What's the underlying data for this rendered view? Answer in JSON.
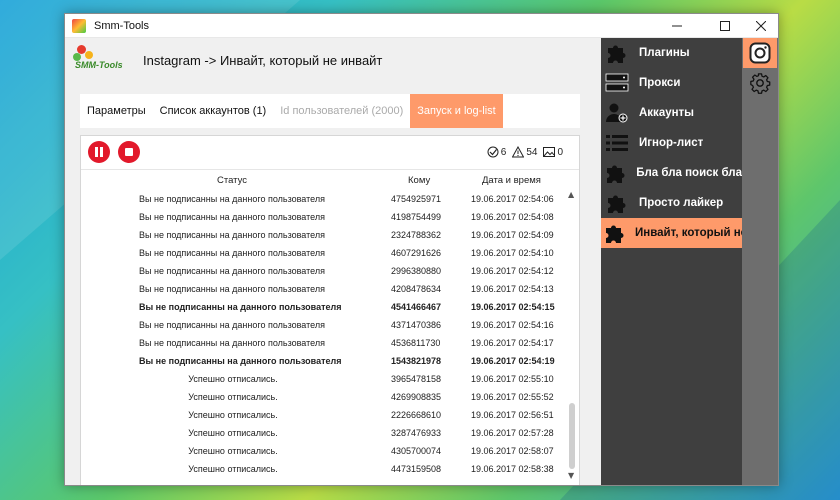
{
  "window": {
    "title": "Smm-Tools"
  },
  "header": {
    "logo_text": "SMM-Tools",
    "title": "Instagram -> Инвайт, который не инвайт"
  },
  "tabs": [
    {
      "label": "Параметры",
      "state": "normal"
    },
    {
      "label": "Список аккаунтов (1)",
      "state": "normal"
    },
    {
      "label": "Id пользователей (2000)",
      "state": "disabled"
    },
    {
      "label": "Запуск и log-list",
      "state": "active"
    }
  ],
  "stats": {
    "success": "6",
    "warnings": "54",
    "images": "0"
  },
  "table": {
    "columns": [
      "Статус",
      "Кому",
      "Дата и время"
    ],
    "rows": [
      {
        "status": "Вы не подписанны на данного пользователя",
        "to": "4754925971",
        "date": "19.06.2017 02:54:06",
        "bold": false
      },
      {
        "status": "Вы не подписанны на данного пользователя",
        "to": "4198754499",
        "date": "19.06.2017 02:54:08",
        "bold": false
      },
      {
        "status": "Вы не подписанны на данного пользователя",
        "to": "2324788362",
        "date": "19.06.2017 02:54:09",
        "bold": false
      },
      {
        "status": "Вы не подписанны на данного пользователя",
        "to": "4607291626",
        "date": "19.06.2017 02:54:10",
        "bold": false
      },
      {
        "status": "Вы не подписанны на данного пользователя",
        "to": "2996380880",
        "date": "19.06.2017 02:54:12",
        "bold": false
      },
      {
        "status": "Вы не подписанны на данного пользователя",
        "to": "4208478634",
        "date": "19.06.2017 02:54:13",
        "bold": false
      },
      {
        "status": "Вы не подписанны на данного пользователя",
        "to": "4541466467",
        "date": "19.06.2017 02:54:15",
        "bold": true
      },
      {
        "status": "Вы не подписанны на данного пользователя",
        "to": "4371470386",
        "date": "19.06.2017 02:54:16",
        "bold": false
      },
      {
        "status": "Вы не подписанны на данного пользователя",
        "to": "4536811730",
        "date": "19.06.2017 02:54:17",
        "bold": false
      },
      {
        "status": "Вы не подписанны на данного пользователя",
        "to": "1543821978",
        "date": "19.06.2017 02:54:19",
        "bold": true
      },
      {
        "status": "Успешно отписались.",
        "to": "3965478158",
        "date": "19.06.2017 02:55:10",
        "bold": false
      },
      {
        "status": "Успешно отписались.",
        "to": "4269908835",
        "date": "19.06.2017 02:55:52",
        "bold": false
      },
      {
        "status": "Успешно отписались.",
        "to": "2226668610",
        "date": "19.06.2017 02:56:51",
        "bold": false
      },
      {
        "status": "Успешно отписались.",
        "to": "3287476933",
        "date": "19.06.2017 02:57:28",
        "bold": false
      },
      {
        "status": "Успешно отписались.",
        "to": "4305700074",
        "date": "19.06.2017 02:58:07",
        "bold": false
      },
      {
        "status": "Успешно отписались.",
        "to": "4473159508",
        "date": "19.06.2017 02:58:38",
        "bold": false
      }
    ]
  },
  "menu": [
    {
      "label": "Плагины",
      "icon": "puzzle-icon",
      "active": false
    },
    {
      "label": "Прокси",
      "icon": "server-icon",
      "active": false
    },
    {
      "label": "Аккаунты",
      "icon": "add-user-icon",
      "active": false
    },
    {
      "label": "Игнор-лист",
      "icon": "list-icon",
      "active": false
    },
    {
      "label": "Бла бла поиск бла",
      "icon": "puzzle-icon",
      "active": false
    },
    {
      "label": "Просто лайкер",
      "icon": "puzzle-icon",
      "active": false
    },
    {
      "label": "Инвайт, который не инвайт",
      "icon": "puzzle-icon",
      "active": true
    }
  ],
  "colors": {
    "accent": "#fe9a6a",
    "danger": "#e2192b",
    "sidebar": "#3f3f3f"
  }
}
